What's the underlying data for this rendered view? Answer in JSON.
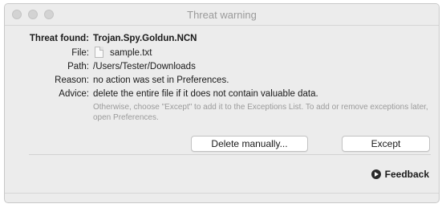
{
  "window": {
    "title": "Threat warning"
  },
  "details": {
    "threat_label": "Threat found:",
    "threat_value": "Trojan.Spy.Goldun.NCN",
    "file_label": "File:",
    "file_value": "sample.txt",
    "path_label": "Path:",
    "path_value": "/Users/Tester/Downloads",
    "reason_label": "Reason:",
    "reason_value": "no action was set in Preferences.",
    "advice_label": "Advice:",
    "advice_value": "delete the entire file if it does not contain valuable data.",
    "advice_hint": "Otherwise, choose \"Except\" to add it to the Exceptions List. To add or remove exceptions later, open Preferences."
  },
  "buttons": {
    "delete_label": "Delete manually...",
    "except_label": "Except"
  },
  "footer": {
    "feedback_label": "Feedback"
  },
  "icons": {
    "file": "document-icon",
    "feedback": "arrow-circle-icon"
  }
}
